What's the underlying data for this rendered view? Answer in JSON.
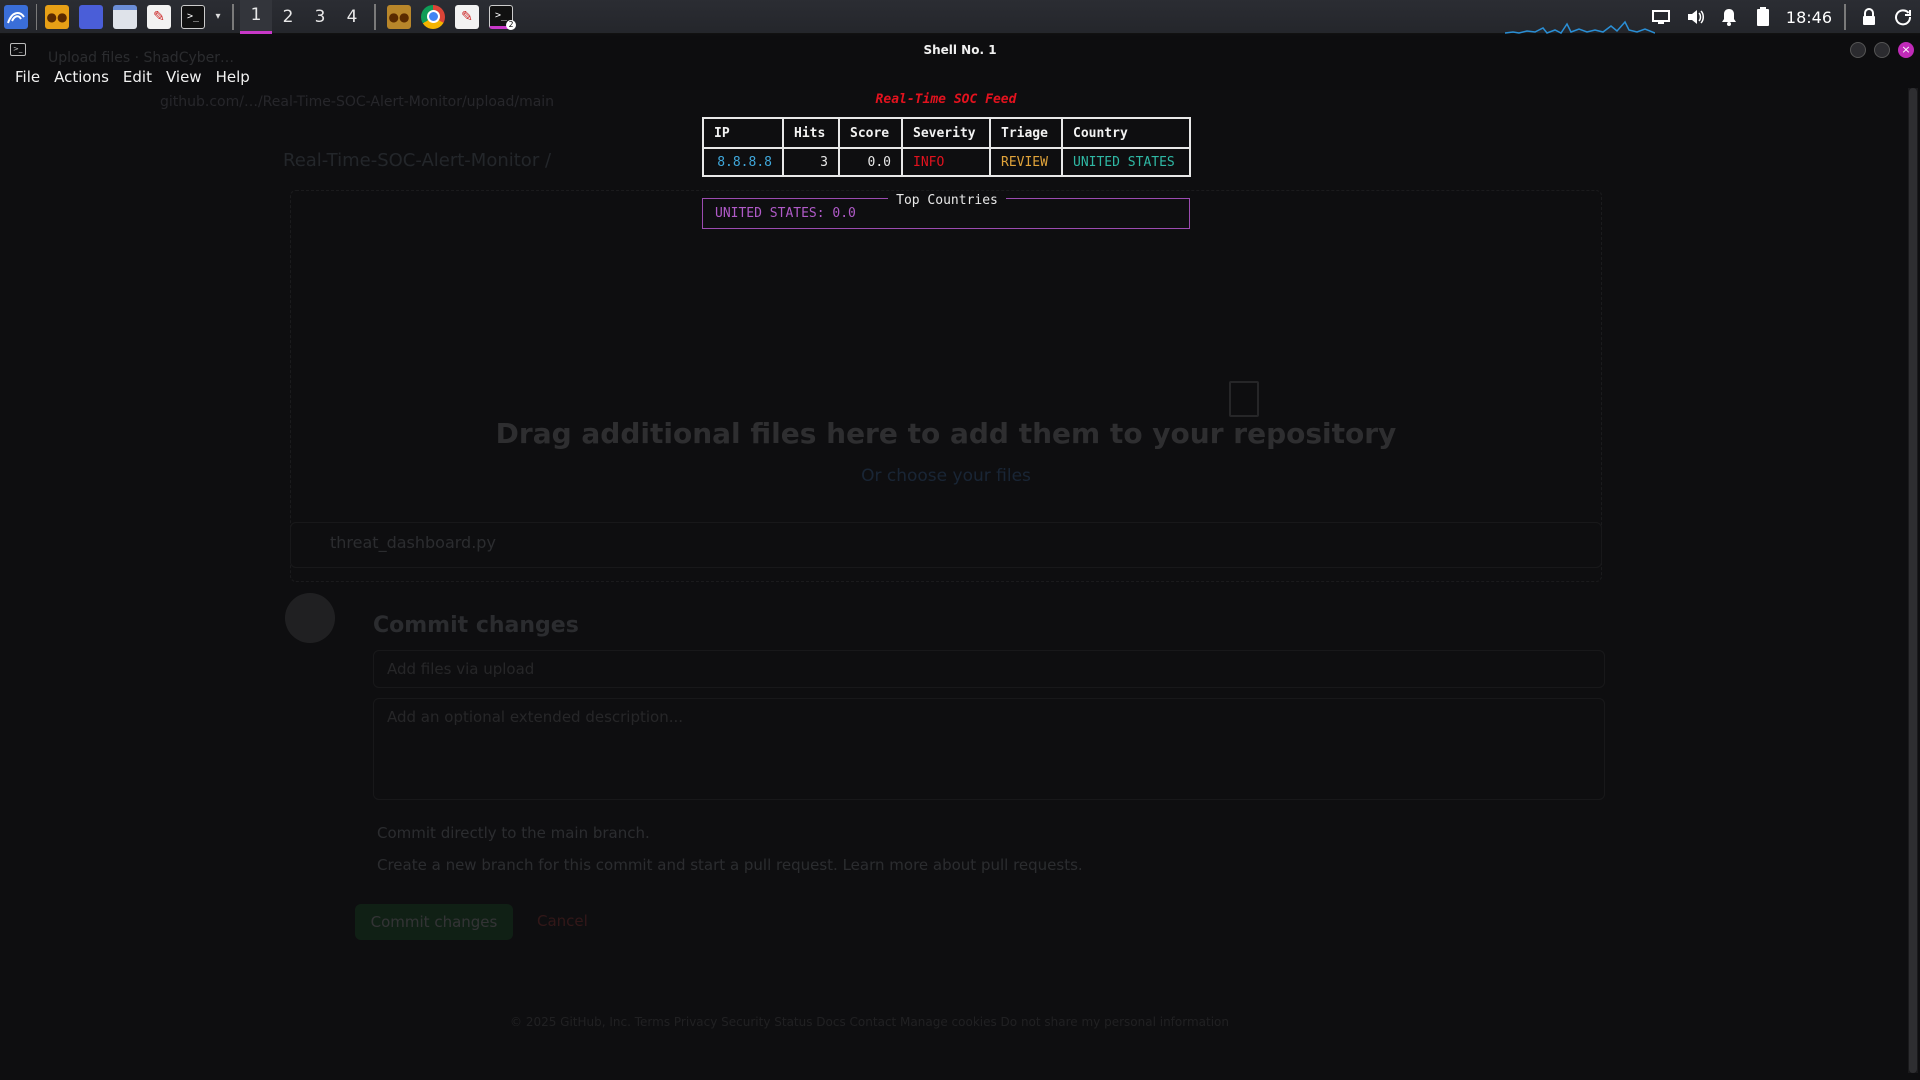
{
  "taskbar": {
    "workspaces": [
      "1",
      "2",
      "3",
      "4"
    ],
    "active_workspace": "1",
    "clock": "18:46",
    "terminal_badge": "2",
    "accent": "#c838c8"
  },
  "window": {
    "title": "Shell No. 1",
    "menu": [
      "File",
      "Actions",
      "Edit",
      "View",
      "Help"
    ]
  },
  "background_page": {
    "tab_title": "Upload files · ShadCyber…",
    "url": "github.com/…/Real-Time-SOC-Alert-Monitor/upload/main",
    "repo_name": "Real-Time-SOC-Alert-Monitor /",
    "drop_heading": "Drag additional files here to add them to your repository",
    "drop_sub": "Or choose your files",
    "file_name": "threat_dashboard.py",
    "commit_title": "Commit changes",
    "commit_placeholder": "Add files via upload",
    "description_placeholder": "Add an optional extended description...",
    "option_direct": "Commit directly to the main branch.",
    "option_branch": "Create a new branch for this commit and start a pull request. Learn more about pull requests.",
    "commit_button": "Commit changes",
    "cancel_button": "Cancel",
    "footer": "© 2025 GitHub, Inc.   Terms   Privacy   Security   Status   Docs   Contact   Manage cookies   Do not share my personal information"
  },
  "feed": {
    "title": "Real-Time SOC Feed",
    "columns": [
      "IP",
      "Hits",
      "Score",
      "Severity",
      "Triage",
      "Country"
    ],
    "rows": [
      {
        "ip": "8.8.8.8",
        "hits": "3",
        "score": "0.0",
        "severity": "INFO",
        "triage": "REVIEW",
        "country": "UNITED STATES"
      }
    ],
    "colors": {
      "ip": "#3fa6d9",
      "severity": "#e3121e",
      "triage": "#e0a33a",
      "country": "#2fb8a4",
      "title": "#e3121e"
    }
  },
  "top_countries": {
    "title": "Top Countries",
    "value": "UNITED STATES: 0.0",
    "border_color": "#9b4bb0"
  }
}
